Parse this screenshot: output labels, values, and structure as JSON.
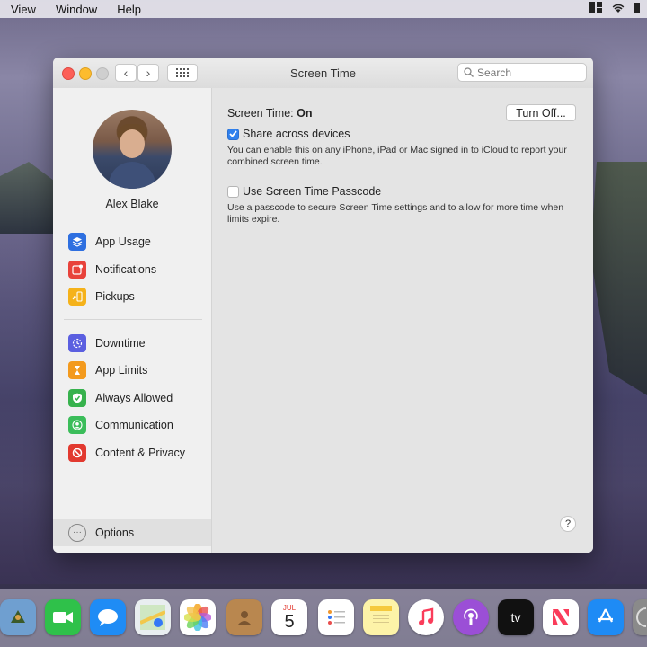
{
  "menubar": {
    "items": [
      "View",
      "Window",
      "Help"
    ]
  },
  "window": {
    "title": "Screen Time",
    "search_placeholder": "Search"
  },
  "sidebar": {
    "user_name": "Alex Blake",
    "group1": [
      {
        "label": "App Usage",
        "icon": "layers-icon",
        "color": "#2e6fe0"
      },
      {
        "label": "Notifications",
        "icon": "notification-icon",
        "color": "#e8423b"
      },
      {
        "label": "Pickups",
        "icon": "pickup-icon",
        "color": "#f5b21a"
      }
    ],
    "group2": [
      {
        "label": "Downtime",
        "icon": "downtime-icon",
        "color": "#5b5fe0"
      },
      {
        "label": "App Limits",
        "icon": "hourglass-icon",
        "color": "#f39a1e"
      },
      {
        "label": "Always Allowed",
        "icon": "checkmark-shield-icon",
        "color": "#37b24d"
      },
      {
        "label": "Communication",
        "icon": "person-icon",
        "color": "#3bbd5a"
      },
      {
        "label": "Content & Privacy",
        "icon": "prohibited-icon",
        "color": "#e2392f"
      }
    ],
    "options_label": "Options"
  },
  "main": {
    "status_prefix": "Screen Time:",
    "status_value": "On",
    "turn_off_label": "Turn Off...",
    "share_label": "Share across devices",
    "share_checked": true,
    "share_desc": "You can enable this on any iPhone, iPad or Mac signed in to iCloud to report your combined screen time.",
    "passcode_label": "Use Screen Time Passcode",
    "passcode_checked": false,
    "passcode_desc": "Use a passcode to secure Screen Time settings and to allow for more time when limits expire.",
    "help_label": "?"
  },
  "dock": {
    "calendar_month": "JUL",
    "calendar_day": "5",
    "tv_label": "tv"
  }
}
